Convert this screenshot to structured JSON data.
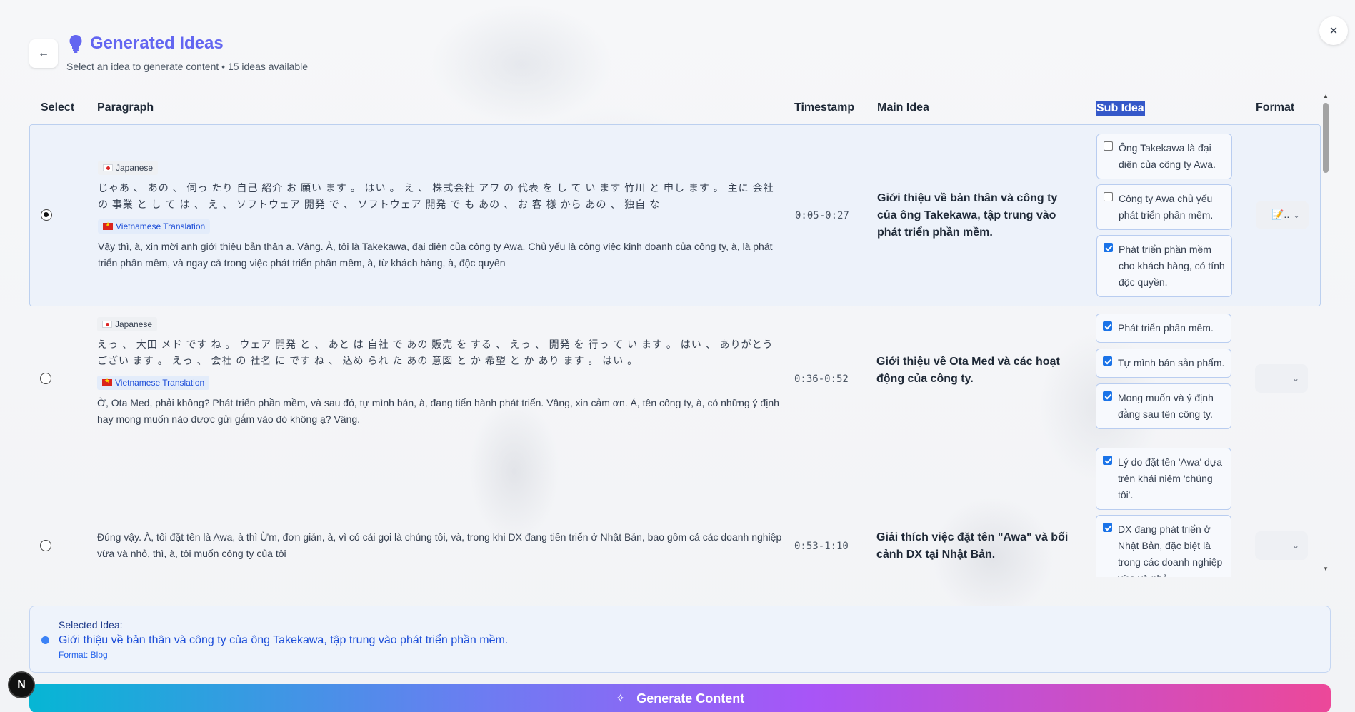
{
  "header": {
    "back_icon": "arrow-left-icon",
    "close_icon": "close-icon",
    "bulb_icon": "lightbulb-icon",
    "title": "Generated Ideas",
    "subtitle": "Select an idea to generate content • 15 ideas available"
  },
  "table": {
    "columns": {
      "select": "Select",
      "paragraph": "Paragraph",
      "timestamp": "Timestamp",
      "main_idea": "Main Idea",
      "sub_idea": "Sub Idea",
      "format": "Format"
    },
    "lang_labels": {
      "japanese": "Japanese",
      "vietnamese": "Vietnamese Translation"
    },
    "rows": [
      {
        "selected": true,
        "japanese": "じゃあ 、 あの 、 伺っ たり 自己 紹介 お 願い ます 。 はい 。 え 、 株式会社 アワ の 代表 を し て い ます 竹川 と 申し ます 。 主に 会社 の 事業 と し て は 、 え 、 ソフトウェア 開発 で 、 ソフトウェア 開発 で も あの 、 お 客 様 から あの 、 独自 な",
        "vietnamese": "Vậy thì, à, xin mời anh giới thiệu bản thân ạ. Vâng. À, tôi là Takekawa, đại diện của công ty Awa. Chủ yếu là công việc kinh doanh của công ty, à, là phát triển phần mềm, và ngay cả trong việc phát triển phần mềm, à, từ khách hàng, à, độc quyền",
        "timestamp": "0:05-0:27",
        "main_idea": "Giới thiệu về bản thân và công ty của ông Takekawa, tập trung vào phát triển phần mềm.",
        "sub_ideas": [
          {
            "text": "Ông Takekawa là đại diện của công ty Awa.",
            "checked": false
          },
          {
            "text": "Công ty Awa chủ yếu phát triển phần mềm.",
            "checked": false
          },
          {
            "text": "Phát triển phần mềm cho khách hàng, có tính độc quyền.",
            "checked": true
          }
        ],
        "format": "📝..",
        "format_chevron": "chevron-down-icon"
      },
      {
        "selected": false,
        "japanese": "えっ 、 大田 メド です ね 。 ウェア 開発 と 、 あと は 自社 で あの 販売 を する 、 えっ 、 開発 を 行っ て い ます 。 はい 、 ありがとう ござい ます 。 えっ 、 会社 の 社名 に です ね 、 込め られ た あの 意図 と か 希望 と か あり ます 。 はい 。",
        "vietnamese": "Ờ, Ota Med, phải không? Phát triển phần mềm, và sau đó, tự mình bán, à, đang tiến hành phát triển. Vâng, xin cảm ơn. À, tên công ty, à, có những ý định hay mong muốn nào được gửi gắm vào đó không ạ? Vâng.",
        "timestamp": "0:36-0:52",
        "main_idea": "Giới thiệu về Ota Med và các hoạt động của công ty.",
        "sub_ideas": [
          {
            "text": "Phát triển phần mềm.",
            "checked": true
          },
          {
            "text": "Tự mình bán sản phẩm.",
            "checked": true
          },
          {
            "text": "Mong muốn và ý định đằng sau tên công ty.",
            "checked": true
          }
        ],
        "format": "",
        "format_chevron": "chevron-down-icon"
      },
      {
        "selected": false,
        "vietnamese": "Đúng vậy. À, tôi đặt tên là Awa, à thì Ừm, đơn giản, à, vì có cái gọi là chúng tôi, và, trong khi DX đang tiến triển ở Nhật Bản, bao gồm cả các doanh nghiệp vừa và nhỏ, thì, à, tôi muốn công ty của tôi",
        "timestamp": "0:53-1:10",
        "main_idea": "Giải thích việc đặt tên \"Awa\" và bối cảnh DX tại Nhật Bản.",
        "sub_ideas": [
          {
            "text": "Lý do đặt tên 'Awa' dựa trên khái niệm 'chúng tôi'.",
            "checked": true
          },
          {
            "text": "DX đang phát triển ở Nhật Bản, đặc biệt là trong các doanh nghiệp vừa và nhỏ.",
            "checked": true
          }
        ],
        "format": "",
        "format_chevron": "chevron-down-icon"
      }
    ]
  },
  "selected_panel": {
    "label": "Selected Idea:",
    "idea": "Giới thiệu về bản thân và công ty của ông Takekawa, tập trung vào phát triển phần mềm.",
    "format": "Format: Blog"
  },
  "generate": {
    "label": "Generate Content",
    "icon": "sparkle-icon"
  },
  "badge": {
    "letter": "N"
  },
  "colors": {
    "accent": "#6366f1",
    "selected_row_bg": "#edf2fa",
    "checkbox_blue": "#1a73e8",
    "generate_gradient": [
      "#06b6d4",
      "#a855f7",
      "#ec4899"
    ]
  }
}
